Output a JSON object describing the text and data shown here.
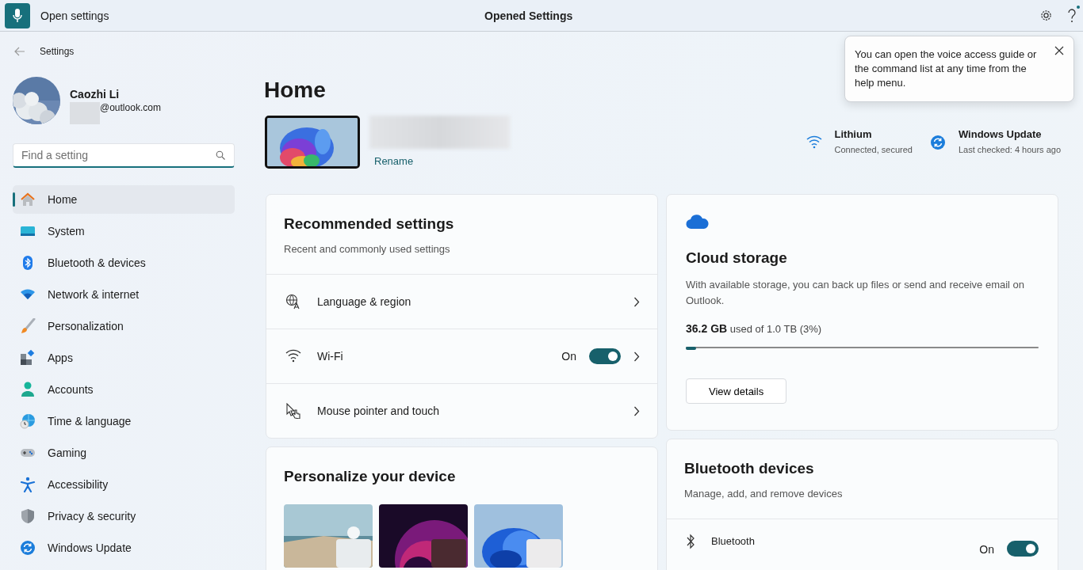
{
  "voice_bar": {
    "command": "Open settings",
    "status": "Opened Settings"
  },
  "tooltip": {
    "text": "You can open the voice access guide or the command list at any time from the help menu."
  },
  "app": {
    "title": "Settings"
  },
  "account": {
    "name": "Caozhi Li",
    "email": "@outlook.com"
  },
  "search": {
    "placeholder": "Find a setting"
  },
  "nav": [
    {
      "label": "Home",
      "selected": true
    },
    {
      "label": "System",
      "selected": false
    },
    {
      "label": "Bluetooth & devices",
      "selected": false
    },
    {
      "label": "Network & internet",
      "selected": false
    },
    {
      "label": "Personalization",
      "selected": false
    },
    {
      "label": "Apps",
      "selected": false
    },
    {
      "label": "Accounts",
      "selected": false
    },
    {
      "label": "Time & language",
      "selected": false
    },
    {
      "label": "Gaming",
      "selected": false
    },
    {
      "label": "Accessibility",
      "selected": false
    },
    {
      "label": "Privacy & security",
      "selected": false
    },
    {
      "label": "Windows Update",
      "selected": false
    }
  ],
  "page_title": "Home",
  "device": {
    "rename": "Rename"
  },
  "status_items": [
    {
      "title": "Lithium",
      "subtitle": "Connected, secured"
    },
    {
      "title": "Windows Update",
      "subtitle": "Last checked: 4 hours ago"
    }
  ],
  "recommended": {
    "title": "Recommended settings",
    "subtitle": "Recent and commonly used settings",
    "rows": [
      {
        "kind": "link",
        "label": "Language & region"
      },
      {
        "kind": "toggle",
        "label": "Wi-Fi",
        "state_label": "On",
        "on": true
      },
      {
        "kind": "link",
        "label": "Mouse pointer and touch"
      }
    ]
  },
  "cloud": {
    "title": "Cloud storage",
    "description": "With available storage, you can back up files or send and receive email on Outlook.",
    "usage": "**36.2 GB** used of 1.0 TB (3%)",
    "level": 0.03,
    "button": "View details"
  },
  "personalize": {
    "title": "Personalize your device"
  },
  "bluetooth": {
    "title": "Bluetooth devices",
    "subtitle": "Manage, add, and remove devices",
    "rows": [
      {
        "label": "Bluetooth",
        "state_label": "On",
        "on": true
      }
    ]
  }
}
